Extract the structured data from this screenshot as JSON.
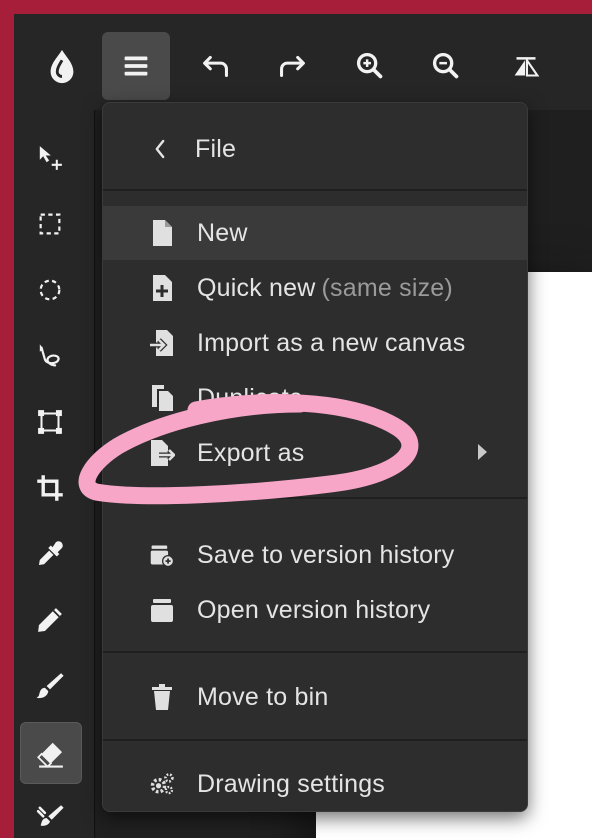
{
  "colors": {
    "frame": "#a61e3a",
    "toolbar": "#262626",
    "menu_bg": "#2d2d2d",
    "menu_text": "#e4e4e4",
    "menu_muted": "#9a9a9a",
    "highlight": "#f7a6c8"
  },
  "toolbar": {
    "items": [
      {
        "icon": "app-logo-drop-icon"
      },
      {
        "icon": "hamburger-menu-icon",
        "active": true
      },
      {
        "icon": "undo-icon"
      },
      {
        "icon": "redo-icon"
      },
      {
        "icon": "zoom-in-icon"
      },
      {
        "icon": "zoom-out-icon"
      },
      {
        "icon": "flip-icon"
      }
    ]
  },
  "tools": [
    {
      "icon": "move-select-icon"
    },
    {
      "icon": "rect-select-icon"
    },
    {
      "icon": "ellipse-select-icon"
    },
    {
      "icon": "lasso-icon"
    },
    {
      "icon": "transform-icon"
    },
    {
      "icon": "crop-icon"
    },
    {
      "icon": "eyedropper-icon"
    },
    {
      "icon": "pencil-icon"
    },
    {
      "icon": "brush-icon"
    },
    {
      "icon": "eraser-icon",
      "active": true
    },
    {
      "icon": "smudge-icon"
    }
  ],
  "menu": {
    "back_label": "File",
    "items": [
      {
        "id": "new",
        "label": "New",
        "icon": "file-icon",
        "hover": true
      },
      {
        "id": "quick-new",
        "label": "Quick new",
        "suffix": "(same size)",
        "icon": "file-plus-icon"
      },
      {
        "id": "import",
        "label": "Import as a new canvas",
        "icon": "file-import-icon"
      },
      {
        "id": "duplicate",
        "label": "Duplicate",
        "icon": "duplicate-icon"
      },
      {
        "id": "export",
        "label": "Export as",
        "icon": "file-export-icon",
        "submenu": true
      },
      {
        "id": "save-version",
        "label": "Save to version history",
        "icon": "save-version-icon"
      },
      {
        "id": "open-version",
        "label": "Open version history",
        "icon": "version-stack-icon"
      },
      {
        "id": "bin",
        "label": "Move to bin",
        "icon": "trash-icon"
      },
      {
        "id": "settings",
        "label": "Drawing settings",
        "icon": "gears-icon"
      }
    ]
  }
}
